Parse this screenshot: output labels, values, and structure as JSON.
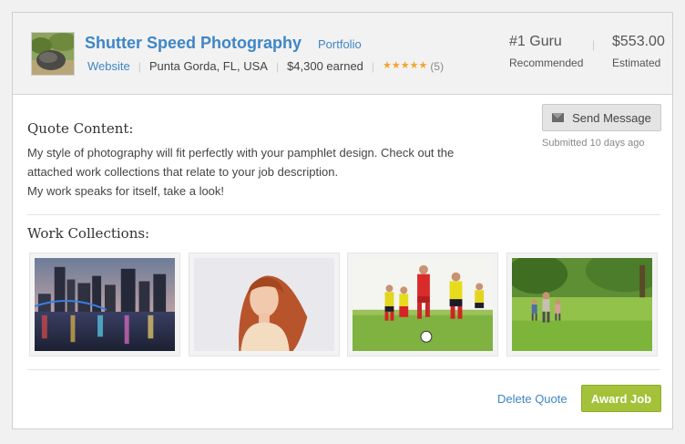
{
  "provider": {
    "name": "Shutter Speed Photography",
    "portfolio_label": "Portfolio",
    "website_label": "Website",
    "location": "Punta Gorda, FL, USA",
    "earned": "$4,300 earned",
    "rating_stars": 5,
    "rating_count": "(5)"
  },
  "stats": {
    "rank": "#1 Guru",
    "rank_label": "Recommended",
    "price": "$553.00",
    "price_label": "Estimated"
  },
  "quote": {
    "section_title": "Quote Content:",
    "lines": [
      "My style of photography will fit perfectly with your pamphlet design. Check out the",
      "attached work collections that relate to your job description.",
      "My work speaks for itself, take a look!"
    ]
  },
  "actions": {
    "send_message": "Send Message",
    "submitted": "Submitted 10 days ago",
    "delete_quote": "Delete Quote",
    "award_job": "Award Job"
  },
  "work": {
    "section_title": "Work Collections:",
    "items": [
      "city-skyline-night",
      "red-haired-woman-portrait",
      "youth-soccer-match",
      "family-walking-in-park"
    ]
  },
  "colors": {
    "link": "#3e86c6",
    "award_button": "#a3c23a",
    "star": "#f3a52b",
    "header_bg": "#f2f2f2"
  },
  "icons": {
    "send_message": "envelope-icon",
    "rating": "star-icon"
  }
}
